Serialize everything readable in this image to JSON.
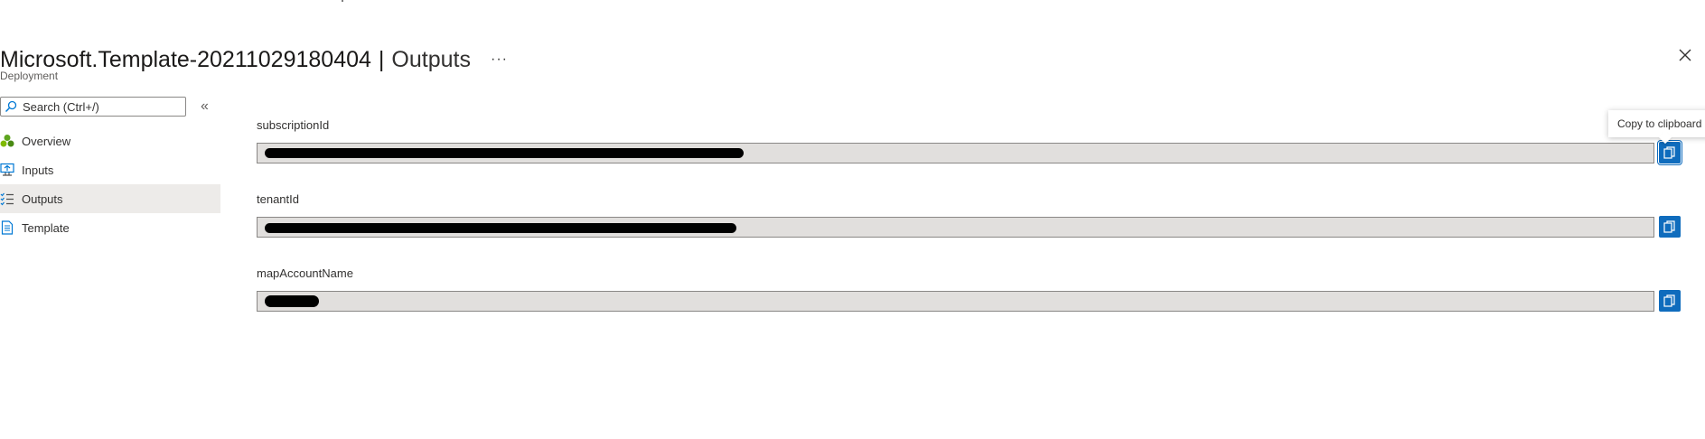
{
  "header": {
    "title": "Microsoft.Template-20211029180404",
    "separator": "|",
    "section": "Outputs",
    "more_label": "···",
    "subtitle": "Deployment"
  },
  "icons": {
    "close": "close-icon",
    "more": "more-icon",
    "search": "search-icon",
    "collapse": "double-chevron-left-icon",
    "copy": "copy-icon"
  },
  "sidebar": {
    "search": {
      "placeholder": "Search (Ctrl+/)",
      "value": ""
    },
    "collapse_label": "«",
    "items": [
      {
        "label": "Overview",
        "icon": "overview-icon",
        "active": false
      },
      {
        "label": "Inputs",
        "icon": "inputs-icon",
        "active": false
      },
      {
        "label": "Outputs",
        "icon": "outputs-icon",
        "active": true
      },
      {
        "label": "Template",
        "icon": "template-icon",
        "active": false
      }
    ]
  },
  "outputs": [
    {
      "label": "subscriptionId",
      "value_redacted": true
    },
    {
      "label": "tenantId",
      "value_redacted": true
    },
    {
      "label": "mapAccountName",
      "value_redacted": true
    }
  ],
  "tooltip": {
    "text": "Copy to clipboard"
  },
  "colors": {
    "accent": "#0f6cbd",
    "active_nav_bg": "#edebe9",
    "field_bg": "#e1dfdd"
  }
}
